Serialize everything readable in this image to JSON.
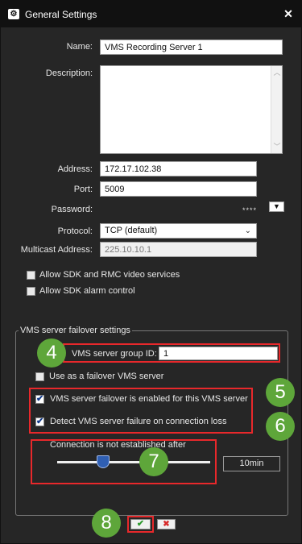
{
  "window": {
    "title": "General Settings",
    "close_icon": "close-icon",
    "settings_icon": "gear-icon"
  },
  "form": {
    "name_label": "Name:",
    "name_value": "VMS Recording Server 1",
    "description_label": "Description:",
    "description_value": "",
    "address_label": "Address:",
    "address_value": "172.17.102.38",
    "port_label": "Port:",
    "port_value": "5009",
    "password_label": "Password:",
    "password_mask": "****",
    "protocol_label": "Protocol:",
    "protocol_value": "TCP (default)",
    "multicast_label": "Multicast Address:",
    "multicast_value": "225.10.10.1",
    "allow_sdk_rmc_label": "Allow SDK and RMC video services",
    "allow_sdk_rmc_checked": false,
    "allow_sdk_alarm_label": "Allow SDK alarm control",
    "allow_sdk_alarm_checked": false
  },
  "failover": {
    "group_title": "VMS server failover settings",
    "group_id_label": "VMS server group ID:",
    "group_id_value": "1",
    "use_as_failover_label": "Use as a failover VMS server",
    "use_as_failover_checked": false,
    "failover_enabled_label": "VMS server failover is enabled for this VMS server",
    "failover_enabled_checked": true,
    "detect_failure_label": "Detect VMS server failure on connection loss",
    "detect_failure_checked": true,
    "connection_label": "Connection is not established after",
    "connection_value": "10min",
    "slider_fraction": 0.32
  },
  "annotations": {
    "badge_4": "4",
    "badge_5": "5",
    "badge_6": "6",
    "badge_7": "7",
    "badge_8": "8",
    "highlight_color": "#e8282b",
    "badge_color": "#5ea63a"
  },
  "buttons": {
    "ok_icon": "checkmark-icon",
    "ok_glyph": "✔",
    "cancel_icon": "x-icon",
    "cancel_glyph": "✖"
  },
  "colors": {
    "dialog_bg": "#262626",
    "titlebar_bg": "#111111",
    "text": "#e8e8e8"
  }
}
